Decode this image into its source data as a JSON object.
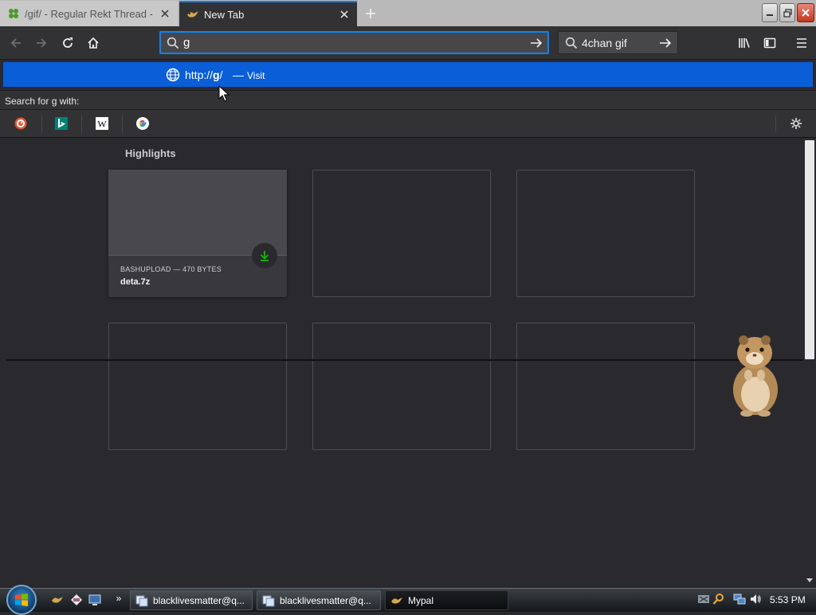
{
  "window": {
    "tabs": [
      {
        "title": "/gif/ - Regular Rekt Thread - An",
        "favicon": "4chan-clover-icon",
        "active": false
      },
      {
        "title": "New Tab",
        "favicon": "mypal-icon",
        "active": true
      }
    ]
  },
  "toolbar": {
    "url_input_value": "g",
    "search_input_value": "4chan gif"
  },
  "autocomplete": {
    "url_prefix": "http://",
    "url_host": "g",
    "url_suffix": "/",
    "separator": "—",
    "action": "Visit",
    "search_for_label": "Search for g with:",
    "engines": [
      "duckduckgo-icon",
      "bing-icon",
      "wikipedia-icon",
      "google-icon"
    ]
  },
  "newtab": {
    "heading": "Highlights",
    "cards": [
      {
        "meta": "BASHUPLOAD — 470 BYTES",
        "name": "deta.7z",
        "icon": "download-icon"
      }
    ]
  },
  "taskbar": {
    "buttons": [
      {
        "label": "blacklivesmatter@q...",
        "icon": "chat-window-icon",
        "active": false
      },
      {
        "label": "blacklivesmatter@q...",
        "icon": "chat-window-icon",
        "active": false
      },
      {
        "label": "Mypal",
        "icon": "mypal-icon",
        "active": true
      }
    ],
    "clock": "5:53 PM"
  },
  "colors": {
    "accent": "#0a84ff",
    "selection": "#0a5ed8",
    "background": "#2a2a2e",
    "download_green": "#12bc00"
  }
}
